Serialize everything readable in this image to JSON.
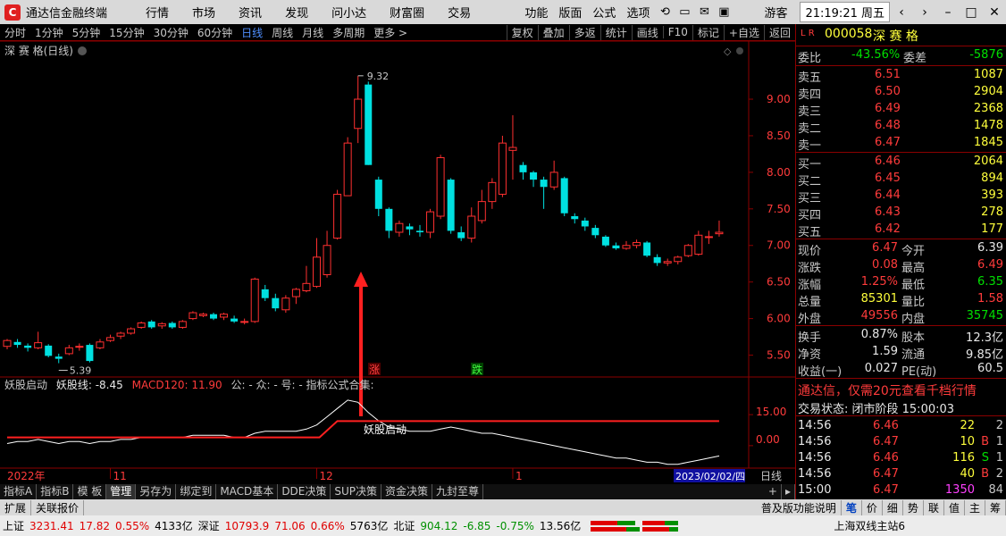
{
  "app": {
    "name": "通达信金融终端",
    "logo_icon": "tdx-logo-icon"
  },
  "menus": [
    "行情",
    "市场",
    "资讯",
    "发现",
    "问小达",
    "财富圈",
    "交易"
  ],
  "right_menus": [
    "功能",
    "版面",
    "公式",
    "选项"
  ],
  "user": "游客",
  "clock": "21:19:21 周五",
  "periods": [
    "分时",
    "1分钟",
    "5分钟",
    "15分钟",
    "30分钟",
    "60分钟",
    "日线",
    "周线",
    "月线",
    "多周期",
    "更多 >"
  ],
  "active_period": "日线",
  "chart_tools": [
    "复权",
    "叠加",
    "多返",
    "统计",
    "画线",
    "F10",
    "标记",
    "+自选",
    "返回"
  ],
  "chart_title": "深 赛 格(日线)",
  "stock": {
    "flags": "L R",
    "code": "000058",
    "name": "深 赛 格"
  },
  "quote": {
    "weibi_label": "委比",
    "weibi": "-43.56%",
    "weicha_label": "委差",
    "weicha": "-5876",
    "asks": [
      {
        "label": "卖五",
        "price": "6.51",
        "vol": "1087"
      },
      {
        "label": "卖四",
        "price": "6.50",
        "vol": "2904"
      },
      {
        "label": "卖三",
        "price": "6.49",
        "vol": "2368"
      },
      {
        "label": "卖二",
        "price": "6.48",
        "vol": "1478"
      },
      {
        "label": "卖一",
        "price": "6.47",
        "vol": "1845"
      }
    ],
    "bids": [
      {
        "label": "买一",
        "price": "6.46",
        "vol": "2064"
      },
      {
        "label": "买二",
        "price": "6.45",
        "vol": "894"
      },
      {
        "label": "买三",
        "price": "6.44",
        "vol": "393"
      },
      {
        "label": "买四",
        "price": "6.43",
        "vol": "278"
      },
      {
        "label": "买五",
        "price": "6.42",
        "vol": "177"
      }
    ],
    "stats": [
      {
        "l1": "现价",
        "v1": "6.47",
        "c1": "red",
        "l2": "今开",
        "v2": "6.39",
        "c2": "wht"
      },
      {
        "l1": "涨跌",
        "v1": "0.08",
        "c1": "red",
        "l2": "最高",
        "v2": "6.49",
        "c2": "red"
      },
      {
        "l1": "涨幅",
        "v1": "1.25%",
        "c1": "red",
        "l2": "最低",
        "v2": "6.35",
        "c2": "grn"
      },
      {
        "l1": "总量",
        "v1": "85301",
        "c1": "yel",
        "l2": "量比",
        "v2": "1.58",
        "c2": "red"
      },
      {
        "l1": "外盘",
        "v1": "49556",
        "c1": "red",
        "l2": "内盘",
        "v2": "35745",
        "c2": "grn"
      }
    ],
    "fund": [
      {
        "l1": "换手",
        "v1": "0.87%",
        "l2": "股本",
        "v2": "12.3亿"
      },
      {
        "l1": "净资",
        "v1": "1.59",
        "l2": "流通",
        "v2": "9.85亿"
      },
      {
        "l1": "收益(一)",
        "v1": "0.027",
        "l2": "PE(动)",
        "v2": "60.5"
      }
    ],
    "ad": "通达信，仅需20元查看千档行情",
    "trade_status": "交易状态: 闭市阶段 15:00:03",
    "ticks": [
      {
        "t": "14:56",
        "p": "6.46",
        "pc": "red",
        "v": "22",
        "vc": "yel",
        "s": "",
        "n": "2"
      },
      {
        "t": "14:56",
        "p": "6.47",
        "pc": "red",
        "v": "10",
        "vc": "yel",
        "s": "B",
        "n": "1"
      },
      {
        "t": "14:56",
        "p": "6.46",
        "pc": "red",
        "v": "116",
        "vc": "yel",
        "s": "S",
        "n": "1"
      },
      {
        "t": "14:56",
        "p": "6.47",
        "pc": "red",
        "v": "40",
        "vc": "yel",
        "s": "B",
        "n": "2"
      },
      {
        "t": "15:00",
        "p": "6.47",
        "pc": "red",
        "v": "1350",
        "vc": "mag",
        "s": "",
        "n": "84"
      }
    ]
  },
  "indicator": {
    "name": "妖股启动",
    "line_label": "妖股线: -8.45",
    "macd_label": "MACD120: 11.90",
    "extra": "公: - 众: - 号: - 指标公式合集:",
    "signal_label": "妖股启动",
    "levels": [
      "15.00",
      "0.00"
    ]
  },
  "markers": {
    "high": "9.32",
    "low": "5.39",
    "zhang": "涨",
    "die": "跌"
  },
  "x_labels": [
    {
      "label": "2022年",
      "i": 0
    },
    {
      "label": "11",
      "i": 10
    },
    {
      "label": "12",
      "i": 30
    },
    {
      "label": "1",
      "i": 49
    }
  ],
  "date_label": "2023/02/02/四",
  "period_label": "日线",
  "tabs": [
    "指标A",
    "指标B",
    "模 板",
    "管理",
    "另存为",
    "绑定到",
    "MACD基本",
    "DDE决策",
    "SUP决策",
    "资金决策",
    "九封至尊"
  ],
  "active_tab": "管理",
  "expand_buttons": [
    "扩展",
    "关联报价"
  ],
  "expand_right": "普及版功能说明",
  "expand_tabs": [
    "笔",
    "价",
    "细",
    "势",
    "联",
    "值",
    "主",
    "筹"
  ],
  "status": {
    "sh": {
      "label": "上证",
      "price": "3231.41",
      "chg": "17.82",
      "pct": "0.55%",
      "amt": "4133亿"
    },
    "sz": {
      "label": "深证",
      "price": "10793.9",
      "chg": "71.06",
      "pct": "0.66%",
      "amt": "5763亿"
    },
    "bz": {
      "label": "北证",
      "price": "904.12",
      "chg": "-6.85",
      "pct": "-0.75%",
      "amt": "13.56亿"
    },
    "server": "上海双线主站6"
  },
  "chart_data": {
    "type": "candlestick",
    "y_ticks": [
      5.5,
      6.0,
      6.5,
      7.0,
      7.5,
      8.0,
      8.5,
      9.0
    ],
    "ylim": [
      5.25,
      9.55
    ],
    "candles": [
      {
        "o": 5.62,
        "c": 5.7,
        "h": 5.72,
        "l": 5.58
      },
      {
        "o": 5.68,
        "c": 5.64,
        "h": 5.72,
        "l": 5.6
      },
      {
        "o": 5.63,
        "c": 5.6,
        "h": 5.66,
        "l": 5.55
      },
      {
        "o": 5.6,
        "c": 5.67,
        "h": 5.82,
        "l": 5.58
      },
      {
        "o": 5.63,
        "c": 5.49,
        "h": 5.65,
        "l": 5.47
      },
      {
        "o": 5.48,
        "c": 5.45,
        "h": 5.52,
        "l": 5.39
      },
      {
        "o": 5.52,
        "c": 5.6,
        "h": 5.64,
        "l": 5.5
      },
      {
        "o": 5.62,
        "c": 5.62,
        "h": 5.66,
        "l": 5.56
      },
      {
        "o": 5.64,
        "c": 5.42,
        "h": 5.66,
        "l": 5.4
      },
      {
        "o": 5.6,
        "c": 5.68,
        "h": 5.72,
        "l": 5.58
      },
      {
        "o": 5.7,
        "c": 5.74,
        "h": 5.78,
        "l": 5.68
      },
      {
        "o": 5.76,
        "c": 5.8,
        "h": 5.82,
        "l": 5.72
      },
      {
        "o": 5.8,
        "c": 5.86,
        "h": 5.88,
        "l": 5.78
      },
      {
        "o": 5.88,
        "c": 5.94,
        "h": 5.96,
        "l": 5.86
      },
      {
        "o": 5.96,
        "c": 5.88,
        "h": 5.98,
        "l": 5.86
      },
      {
        "o": 5.9,
        "c": 5.93,
        "h": 5.95,
        "l": 5.86
      },
      {
        "o": 5.94,
        "c": 5.88,
        "h": 5.96,
        "l": 5.86
      },
      {
        "o": 5.88,
        "c": 5.96,
        "h": 5.98,
        "l": 5.86
      },
      {
        "o": 6.0,
        "c": 6.08,
        "h": 6.1,
        "l": 5.98
      },
      {
        "o": 6.04,
        "c": 6.06,
        "h": 6.08,
        "l": 6.02
      },
      {
        "o": 6.06,
        "c": 6.0,
        "h": 6.08,
        "l": 5.98
      },
      {
        "o": 6.02,
        "c": 6.06,
        "h": 6.08,
        "l": 5.98
      },
      {
        "o": 6.0,
        "c": 5.96,
        "h": 6.04,
        "l": 5.94
      },
      {
        "o": 5.96,
        "c": 5.96,
        "h": 6.0,
        "l": 5.92
      },
      {
        "o": 5.96,
        "c": 6.54,
        "h": 6.56,
        "l": 5.94
      },
      {
        "o": 6.4,
        "c": 6.28,
        "h": 6.46,
        "l": 6.24
      },
      {
        "o": 6.28,
        "c": 6.14,
        "h": 6.34,
        "l": 6.1
      },
      {
        "o": 6.12,
        "c": 6.28,
        "h": 6.32,
        "l": 6.08
      },
      {
        "o": 6.3,
        "c": 6.4,
        "h": 6.42,
        "l": 6.2
      },
      {
        "o": 6.38,
        "c": 6.48,
        "h": 6.72,
        "l": 6.36
      },
      {
        "o": 6.44,
        "c": 6.84,
        "h": 7.1,
        "l": 6.42
      },
      {
        "o": 6.6,
        "c": 7.0,
        "h": 7.2,
        "l": 6.56
      },
      {
        "o": 7.1,
        "c": 7.7,
        "h": 7.76,
        "l": 7.08
      },
      {
        "o": 7.68,
        "c": 8.4,
        "h": 8.48,
        "l": 7.68
      },
      {
        "o": 8.6,
        "c": 9.0,
        "h": 9.32,
        "l": 8.4
      },
      {
        "o": 9.2,
        "c": 8.1,
        "h": 9.24,
        "l": 8.1
      },
      {
        "o": 7.9,
        "c": 7.5,
        "h": 7.94,
        "l": 7.4
      },
      {
        "o": 7.5,
        "c": 7.2,
        "h": 7.52,
        "l": 7.1
      },
      {
        "o": 7.18,
        "c": 7.3,
        "h": 7.34,
        "l": 7.12
      },
      {
        "o": 7.26,
        "c": 7.22,
        "h": 7.3,
        "l": 7.14
      },
      {
        "o": 7.2,
        "c": 7.18,
        "h": 7.28,
        "l": 7.12
      },
      {
        "o": 7.18,
        "c": 7.46,
        "h": 7.5,
        "l": 7.1
      },
      {
        "o": 7.4,
        "c": 8.2,
        "h": 8.24,
        "l": 7.36
      },
      {
        "o": 7.9,
        "c": 7.2,
        "h": 7.92,
        "l": 7.16
      },
      {
        "o": 7.18,
        "c": 7.1,
        "h": 7.26,
        "l": 7.06
      },
      {
        "o": 7.1,
        "c": 7.4,
        "h": 7.52,
        "l": 7.04
      },
      {
        "o": 7.34,
        "c": 7.6,
        "h": 7.76,
        "l": 7.3
      },
      {
        "o": 7.6,
        "c": 7.86,
        "h": 7.92,
        "l": 7.5
      },
      {
        "o": 7.7,
        "c": 8.4,
        "h": 8.5,
        "l": 7.66
      },
      {
        "o": 8.3,
        "c": 8.34,
        "h": 8.78,
        "l": 7.9
      },
      {
        "o": 8.1,
        "c": 8.0,
        "h": 8.14,
        "l": 7.9
      },
      {
        "o": 8.0,
        "c": 7.9,
        "h": 8.02,
        "l": 7.8
      },
      {
        "o": 7.9,
        "c": 7.8,
        "h": 7.94,
        "l": 7.5
      },
      {
        "o": 7.8,
        "c": 8.0,
        "h": 8.16,
        "l": 7.76
      },
      {
        "o": 7.92,
        "c": 7.44,
        "h": 7.94,
        "l": 7.4
      },
      {
        "o": 7.4,
        "c": 7.36,
        "h": 7.44,
        "l": 7.3
      },
      {
        "o": 7.34,
        "c": 7.26,
        "h": 7.38,
        "l": 7.2
      },
      {
        "o": 7.24,
        "c": 7.14,
        "h": 7.28,
        "l": 7.1
      },
      {
        "o": 7.12,
        "c": 7.0,
        "h": 7.14,
        "l": 6.98
      },
      {
        "o": 7.0,
        "c": 6.96,
        "h": 7.04,
        "l": 6.94
      },
      {
        "o": 6.96,
        "c": 7.0,
        "h": 7.06,
        "l": 6.94
      },
      {
        "o": 7.0,
        "c": 7.04,
        "h": 7.08,
        "l": 6.96
      },
      {
        "o": 7.04,
        "c": 6.86,
        "h": 7.06,
        "l": 6.84
      },
      {
        "o": 6.84,
        "c": 6.76,
        "h": 6.88,
        "l": 6.72
      },
      {
        "o": 6.76,
        "c": 6.78,
        "h": 6.82,
        "l": 6.72
      },
      {
        "o": 6.78,
        "c": 6.84,
        "h": 6.86,
        "l": 6.74
      },
      {
        "o": 6.86,
        "c": 7.0,
        "h": 7.02,
        "l": 6.84
      },
      {
        "o": 6.88,
        "c": 7.14,
        "h": 7.2,
        "l": 6.86
      },
      {
        "o": 7.12,
        "c": 7.12,
        "h": 7.2,
        "l": 7.02
      },
      {
        "o": 7.16,
        "c": 7.18,
        "h": 7.34,
        "l": 7.12
      }
    ],
    "indicator_line": [
      1,
      2,
      2,
      3,
      2,
      1,
      2,
      2,
      1,
      2,
      2,
      3,
      3,
      4,
      4,
      4,
      4,
      4,
      5,
      5,
      5,
      5,
      4,
      4,
      6,
      7,
      7,
      7,
      7,
      8,
      10,
      14,
      18,
      22,
      21,
      16,
      12,
      9,
      8,
      7,
      7,
      7,
      8,
      9,
      8,
      7,
      6,
      6,
      5,
      4,
      3,
      2,
      1,
      0,
      -1,
      -2,
      -3,
      -4,
      -5,
      -6,
      -6,
      -7,
      -8,
      -8,
      -9,
      -9,
      -8,
      -7,
      -6,
      -5
    ],
    "macd_line": {
      "pre": 4,
      "post": 11.9,
      "switch_index": 32
    },
    "ind_ylim": [
      -10,
      25
    ]
  }
}
